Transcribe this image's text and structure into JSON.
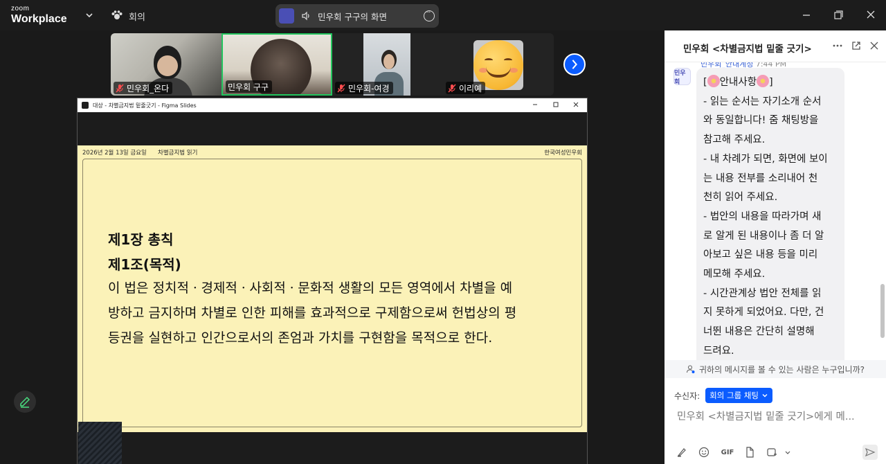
{
  "topbar": {
    "logo_line1": "zoom",
    "logo_line2": "Workplace",
    "meeting_label": "회의",
    "share_label": "민우회 구구의 화면"
  },
  "participants": [
    {
      "name": "민우회_온다",
      "muted": true
    },
    {
      "name": "민우회 구구",
      "muted": false,
      "active_speaker": true
    },
    {
      "name": "민우회-여경",
      "muted": true
    },
    {
      "name": "이리예",
      "muted": true
    }
  ],
  "shared_window": {
    "title": "대상 - 차별금지법 밑줄긋기 - Figma Slides",
    "slide": {
      "date": "2026년 2월 13일 금요일",
      "topic": "차별금지법 읽기",
      "org": "한국여성민우회",
      "chapter": "제1장 총칙",
      "article": "제1조(목적)",
      "body_lines": [
        "이 법은 정치적ㆍ경제적ㆍ사회적ㆍ문화적 생활의 모든 영역에서 차별을 예",
        "방하고 금지하며 차별로 인한 피해를 효과적으로 구제함으로써 헌법상의 평",
        "등권을 실현하고 인간으로서의 존엄과 가치를 구현함을 목적으로 한다."
      ]
    }
  },
  "chat": {
    "title": "민우회 <차별금지법 밑줄 긋기>",
    "sender": "민우회_안내계정",
    "time": "7:44 PM",
    "avatar_text": "민우회",
    "message_lines": [
      "안내사항",
      "- 읽는 순서는 자기소개 순서",
      "와 동일합니다! 줌 채팅방을",
      "참고해 주세요.",
      "- 내 차례가 되면, 화면에 보이",
      "는 내용 전부를 소리내어 천",
      "천히 읽어 주세요.",
      "- 법안의 내용을 따라가며 새",
      "로 알게 된 내용이나 좀 더 알",
      "아보고 싶은 내용 등을 미리",
      "메모해 주세요.",
      "- 시간관계상 법안 전체를 읽",
      "지 못하게 되었어요. 다만, 건",
      "너뛴 내용은 간단히 설명해",
      "드려요."
    ],
    "privacy_text": "귀하의 메시지를 볼 수 있는 사람은 누구입니까?",
    "recipient_label": "수신자:",
    "recipient_value": "회의 그룹 채팅",
    "input_placeholder": "민우회 <차별금지법 밑줄 긋기>에게 메...",
    "gif_label": "GIF"
  },
  "colors": {
    "accent": "#0b5cff",
    "slide_bg": "#fbf2b8",
    "active_speaker": "#22c55e",
    "muted_icon": "#ff4d4f"
  }
}
